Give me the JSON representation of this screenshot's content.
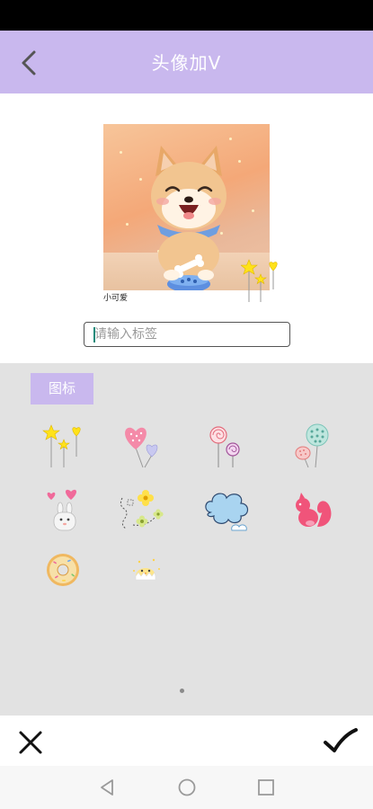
{
  "app_bar": {
    "title": "头像加V"
  },
  "editor": {
    "photo_caption": "小可爱"
  },
  "tag_input": {
    "placeholder": "请输入标签",
    "value": ""
  },
  "panel": {
    "tab_label": "图标",
    "stickers": [
      "stars-hearts-sticker",
      "heart-balloons-sticker",
      "lollipops-sticker",
      "dotted-balloons-sticker",
      "bunny-hearts-sticker",
      "flowers-sticker",
      "cloud-sticker",
      "squirrel-sticker",
      "donut-sticker",
      "chick-sticker"
    ],
    "page_indicator": {
      "current": 1,
      "total": 1
    }
  },
  "colors": {
    "accent": "#c9b8ee",
    "panel_bg": "#e2e2e2",
    "status_bar": "#000000"
  }
}
